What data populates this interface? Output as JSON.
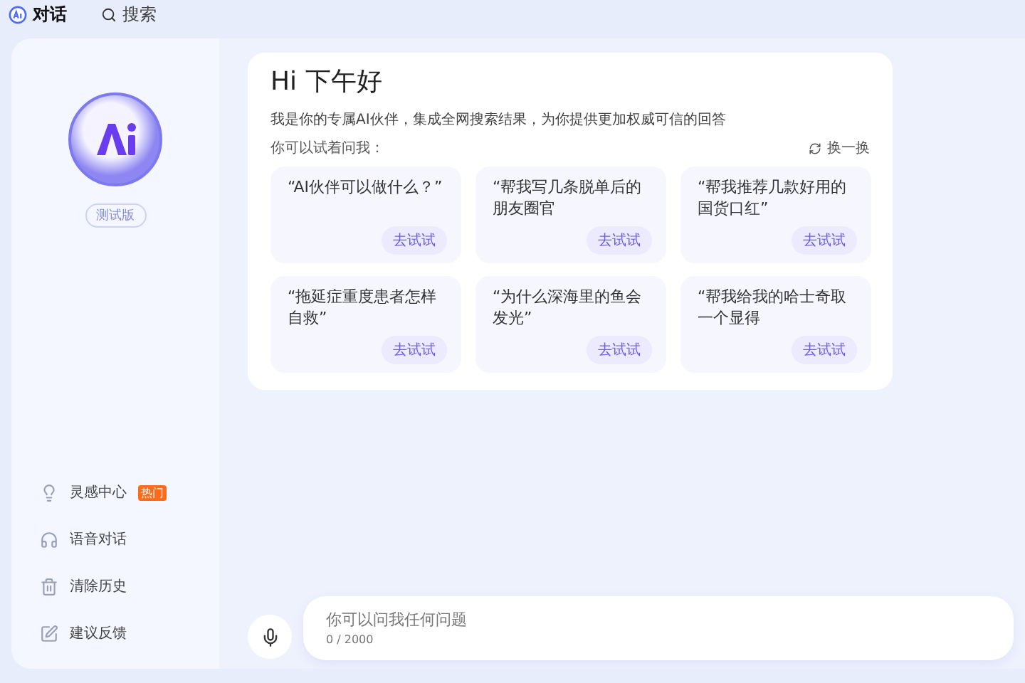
{
  "top_tabs": [
    {
      "label": "对话",
      "selected": true
    },
    {
      "label": "搜索",
      "selected": false
    }
  ],
  "sidebar": {
    "badge": "测试版",
    "items": [
      {
        "label": "灵感中心",
        "tag": "热门"
      },
      {
        "label": "语音对话"
      },
      {
        "label": "清除历史"
      },
      {
        "label": "建议反馈"
      }
    ]
  },
  "greeting": {
    "title": "Hi 下午好",
    "intro": "我是你的专属AI伙伴，集成全网搜索结果，为你提供更加权威可信的回答",
    "prompt_label": "你可以试着问我：",
    "refresh": "换一换"
  },
  "suggestions": [
    {
      "text": "“AI伙伴可以做什么？”",
      "button": "去试试"
    },
    {
      "text": "“帮我写几条脱单后的朋友圈官",
      "button": "去试试"
    },
    {
      "text": "“帮我推荐几款好用的国货口红”",
      "button": "去试试"
    },
    {
      "text": "“拖延症重度患者怎样自救”",
      "button": "去试试"
    },
    {
      "text": "“为什么深海里的鱼会发光”",
      "button": "去试试"
    },
    {
      "text": "“帮我给我的哈士奇取一个显得",
      "button": "去试试"
    }
  ],
  "input": {
    "placeholder": "你可以问我任何问题",
    "counter": "0 / 2000"
  }
}
